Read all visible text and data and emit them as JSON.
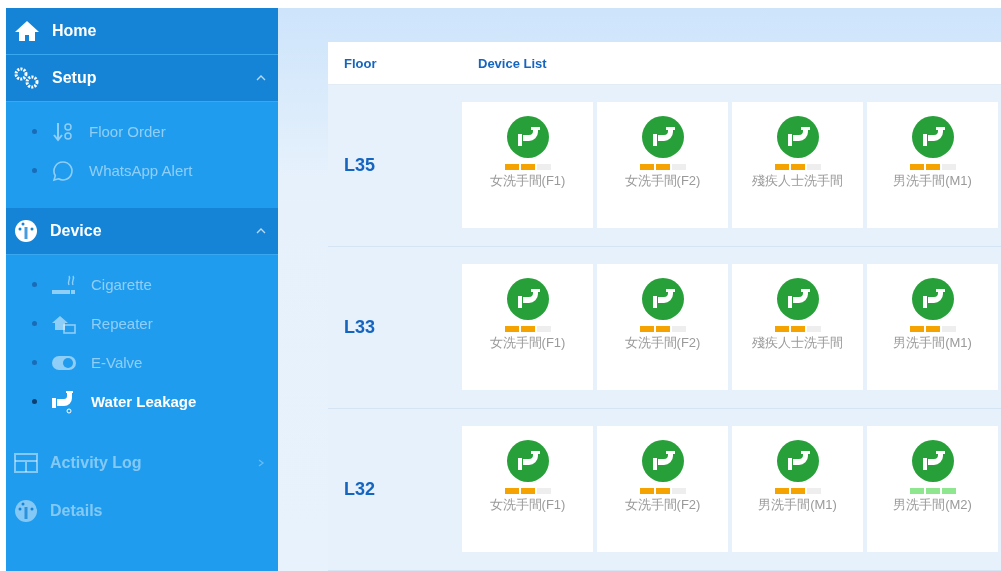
{
  "sidebar": {
    "items": [
      {
        "label": "Home",
        "disabled": false
      },
      {
        "label": "Setup",
        "disabled": false,
        "expanded": true,
        "children": [
          {
            "label": "Floor Order",
            "selected": false
          },
          {
            "label": "WhatsApp Alert",
            "selected": false
          }
        ]
      },
      {
        "label": "Device",
        "disabled": false,
        "expanded": true,
        "children": [
          {
            "label": "Cigarette",
            "selected": false
          },
          {
            "label": "Repeater",
            "selected": false
          },
          {
            "label": "E-Valve",
            "selected": false
          },
          {
            "label": "Water Leakage",
            "selected": true
          }
        ]
      },
      {
        "label": "Activity Log",
        "disabled": true,
        "expanded": false
      },
      {
        "label": "Details",
        "disabled": true
      }
    ]
  },
  "table": {
    "columns": [
      "Floor",
      "Device List"
    ],
    "rows": [
      {
        "floor": "L35",
        "devices": [
          {
            "name": "女洗手間(F1)",
            "level": 0.67,
            "color": "#f5a300"
          },
          {
            "name": "女洗手間(F2)",
            "level": 0.67,
            "color": "#f5a300"
          },
          {
            "name": "殘疾人士洗手間",
            "level": 0.67,
            "color": "#f5a300"
          },
          {
            "name": "男洗手間(M1)",
            "level": 0.67,
            "color": "#f5a300"
          }
        ]
      },
      {
        "floor": "L33",
        "devices": [
          {
            "name": "女洗手間(F1)",
            "level": 0.67,
            "color": "#f5a300"
          },
          {
            "name": "女洗手間(F2)",
            "level": 0.67,
            "color": "#f5a300"
          },
          {
            "name": "殘疾人士洗手間",
            "level": 0.67,
            "color": "#f5a300"
          },
          {
            "name": "男洗手間(M1)",
            "level": 0.67,
            "color": "#f5a300"
          }
        ]
      },
      {
        "floor": "L32",
        "devices": [
          {
            "name": "女洗手間(F1)",
            "level": 0.67,
            "color": "#f5a300"
          },
          {
            "name": "女洗手間(F2)",
            "level": 0.67,
            "color": "#f5a300"
          },
          {
            "name": "男洗手間(M1)",
            "level": 0.67,
            "color": "#f5a300"
          },
          {
            "name": "男洗手間(M2)",
            "level": 1,
            "color": "#8ee68e"
          }
        ]
      }
    ]
  }
}
